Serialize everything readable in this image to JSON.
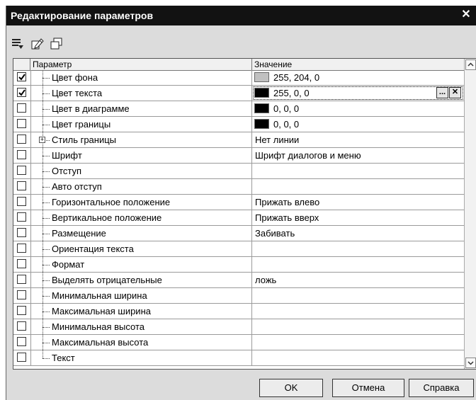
{
  "window": {
    "title": "Редактирование параметров",
    "close_symbol": "✕"
  },
  "toolbar": {
    "icons": [
      "list-filter-icon",
      "edit-icon",
      "copy-icon"
    ]
  },
  "table": {
    "headers": [
      "Параметр",
      "Значение"
    ],
    "rows": [
      {
        "checked": true,
        "name": "Цвет фона",
        "value": "255, 204, 0",
        "swatch": "#c0c0c0"
      },
      {
        "checked": true,
        "name": "Цвет текста",
        "value": "255, 0, 0",
        "swatch": "#000000",
        "selected": true,
        "buttons": [
          "...",
          "✕"
        ]
      },
      {
        "checked": false,
        "name": "Цвет в диаграмме",
        "value": "0, 0, 0",
        "swatch": "#000000"
      },
      {
        "checked": false,
        "name": "Цвет границы",
        "value": "0, 0, 0",
        "swatch": "#000000"
      },
      {
        "checked": false,
        "name": "Стиль границы",
        "value": "Нет линии",
        "expandable": true
      },
      {
        "checked": false,
        "name": "Шрифт",
        "value": "Шрифт диалогов и меню"
      },
      {
        "checked": false,
        "name": "Отступ",
        "value": ""
      },
      {
        "checked": false,
        "name": "Авто отступ",
        "value": ""
      },
      {
        "checked": false,
        "name": "Горизонтальное положение",
        "value": "Прижать влево"
      },
      {
        "checked": false,
        "name": "Вертикальное положение",
        "value": "Прижать вверх"
      },
      {
        "checked": false,
        "name": "Размещение",
        "value": "Забивать"
      },
      {
        "checked": false,
        "name": "Ориентация текста",
        "value": ""
      },
      {
        "checked": false,
        "name": "Формат",
        "value": ""
      },
      {
        "checked": false,
        "name": "Выделять отрицательные",
        "value": "ложь"
      },
      {
        "checked": false,
        "name": "Минимальная ширина",
        "value": ""
      },
      {
        "checked": false,
        "name": "Максимальная ширина",
        "value": ""
      },
      {
        "checked": false,
        "name": "Минимальная высота",
        "value": ""
      },
      {
        "checked": false,
        "name": "Максимальная высота",
        "value": ""
      },
      {
        "checked": false,
        "name": "Текст",
        "value": "",
        "last": true
      }
    ]
  },
  "buttons": {
    "ok": "OK",
    "cancel": "Отмена",
    "help": "Справка"
  }
}
